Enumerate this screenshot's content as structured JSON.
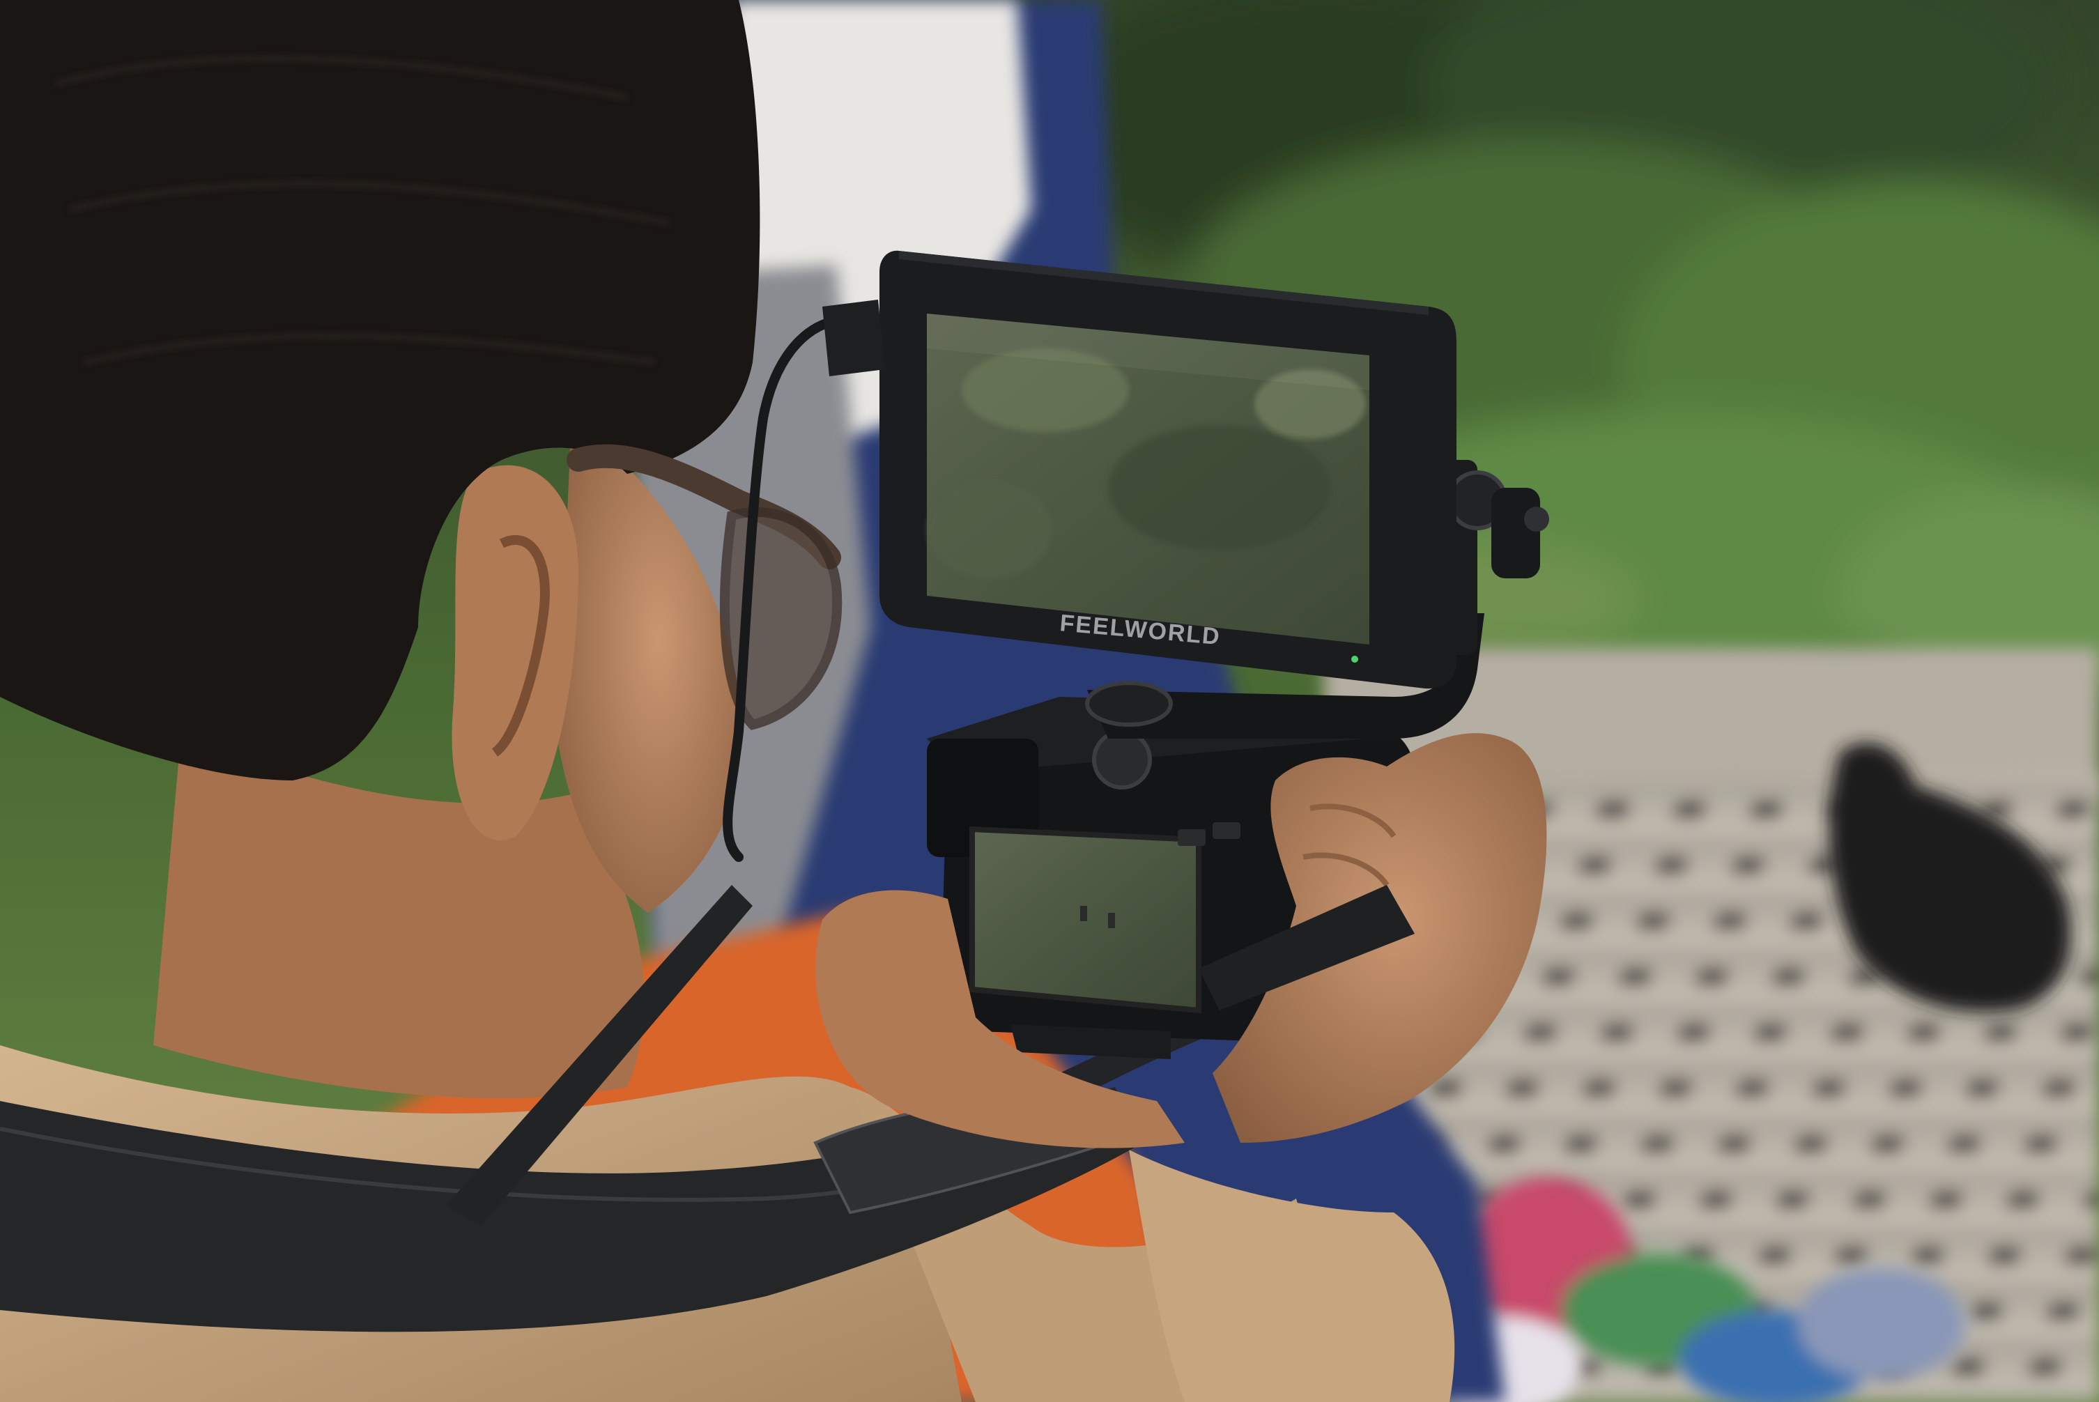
{
  "photo": {
    "subject": "person-filming-with-camera-and-field-monitor",
    "monitor": {
      "brand_text": "FEELWORLD"
    },
    "colors": {
      "foliage": "#3f5a2e",
      "foliage_light": "#6c8a4a",
      "jacket": "#c9a882",
      "skin": "#b98763",
      "hair": "#1a1614",
      "tarp_orange": "#d9652a",
      "tarp_blue": "#2b3b73",
      "pavement": "#b9b3a7",
      "monitor_body": "#1b1c1e",
      "strap": "#252628"
    }
  }
}
